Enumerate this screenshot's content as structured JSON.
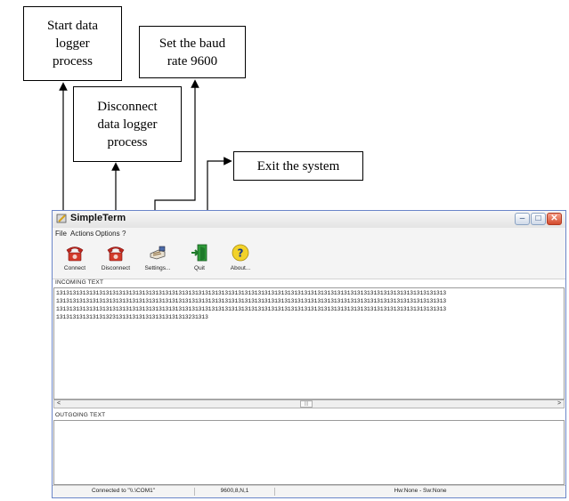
{
  "annotations": {
    "start": "Start data\nlogger\nprocess",
    "baud": "Set the baud\nrate 9600",
    "disconnect": "Disconnect\ndata logger\nprocess",
    "exit": "Exit the system"
  },
  "window": {
    "title": "SimpleTerm",
    "buttons": {
      "minimize": "–",
      "maximize": "□",
      "close": "✕"
    }
  },
  "menu": [
    "File",
    "Actions",
    "Options",
    "?"
  ],
  "toolbar": [
    {
      "label": "Connect",
      "icon": "red-telephone-icon"
    },
    {
      "label": "Disconnect",
      "icon": "red-telephone-icon"
    },
    {
      "label": "Settings...",
      "icon": "settings-hand-icon"
    },
    {
      "label": "Quit",
      "icon": "exit-door-icon"
    },
    {
      "label": "About...",
      "icon": "question-icon"
    }
  ],
  "incoming": {
    "label": "INCOMING TEXT",
    "lines": [
      "1313131313131313131313131313131313131313131313131313131313131313131313131313131313131313131313131313131313131313131313",
      "1313131313131313131313131313131313131313131313131313131313131313131313131313131313131313131313131313131313131313131313",
      "1313131313131313131313131313131313131313131313131313131313131313131313131313131313131313131313131313131313131313131313",
      "1313131313131313231313131313131313131313231313"
    ]
  },
  "scroll": {
    "left": "<",
    "right": ">",
    "thumb": "|||"
  },
  "outgoing": {
    "label": "OUTGOING TEXT",
    "text": ""
  },
  "status": {
    "connection": "Connected to \"\\\\.\\COM1\"",
    "settings": "9600,8,N,1",
    "flow": "Hw:None - Sw:None"
  },
  "colors": {
    "titlebar_border": "#6b86c9",
    "close_button": "#d24a2c",
    "quit_icon": "#2f9a3a"
  }
}
